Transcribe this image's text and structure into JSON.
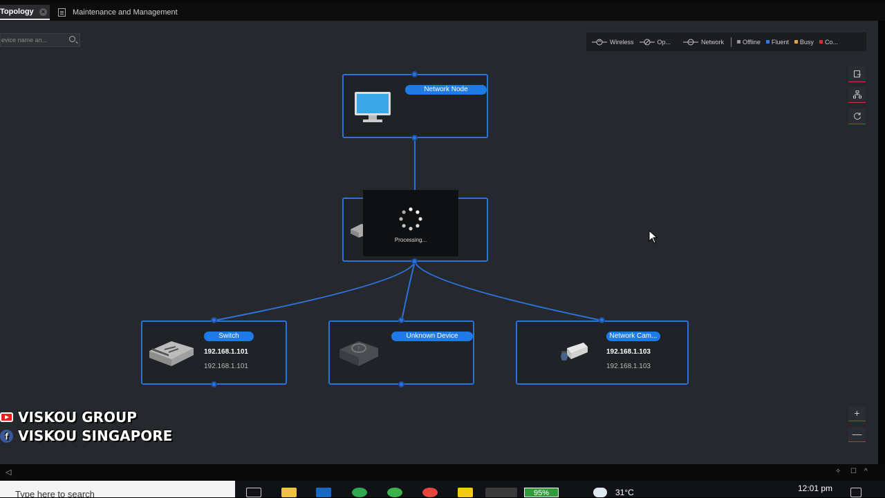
{
  "tabs": [
    {
      "label": "Topology",
      "active": true
    },
    {
      "label": "Maintenance and Management",
      "active": false
    }
  ],
  "search": {
    "placeholder": "evice name an..."
  },
  "legend": {
    "items": [
      {
        "label": "Wireless",
        "icon": "wireless-link-icon"
      },
      {
        "label": "Op...",
        "icon": "optical-link-icon"
      },
      {
        "label": "Network",
        "icon": "network-link-icon"
      }
    ],
    "status": [
      {
        "label": "Offline",
        "color": "#9a9a9a"
      },
      {
        "label": "Fluent",
        "color": "#2d7be6"
      },
      {
        "label": "Busy",
        "color": "#e3a33a"
      },
      {
        "label": "Co...",
        "color": "#d63030"
      }
    ]
  },
  "right_tools": [
    "export-icon",
    "topology-layout-icon",
    "refresh-icon"
  ],
  "nodes": {
    "root": {
      "label": "Network Node",
      "icon": "monitor-icon"
    },
    "middle": {
      "icon": "switch-icon"
    },
    "switch": {
      "label": "Switch",
      "ip_bold": "192.168.1.101",
      "ip": "192.168.1.101",
      "icon": "switch-icon"
    },
    "unknown": {
      "label": "Unknown Device",
      "icon": "unknown-device-icon"
    },
    "camera": {
      "label": "Network Cam...",
      "ip_bold": "192.168.1.103",
      "ip": "192.168.1.103",
      "icon": "bullet-camera-icon"
    }
  },
  "processing": {
    "label": "Processing..."
  },
  "watermark": {
    "line1": "VISKOU GROUP",
    "line2": "VISKOU SINGAPORE"
  },
  "zoom": {
    "in": "+",
    "out": "—"
  },
  "taskbar": {
    "search_placeholder": "Type here to search",
    "battery": "95%",
    "temperature": "31°C",
    "time": "12:01 pm"
  },
  "colors": {
    "accent": "#2d72d9",
    "pill": "#1e7be6",
    "canvas": "#25282c"
  }
}
